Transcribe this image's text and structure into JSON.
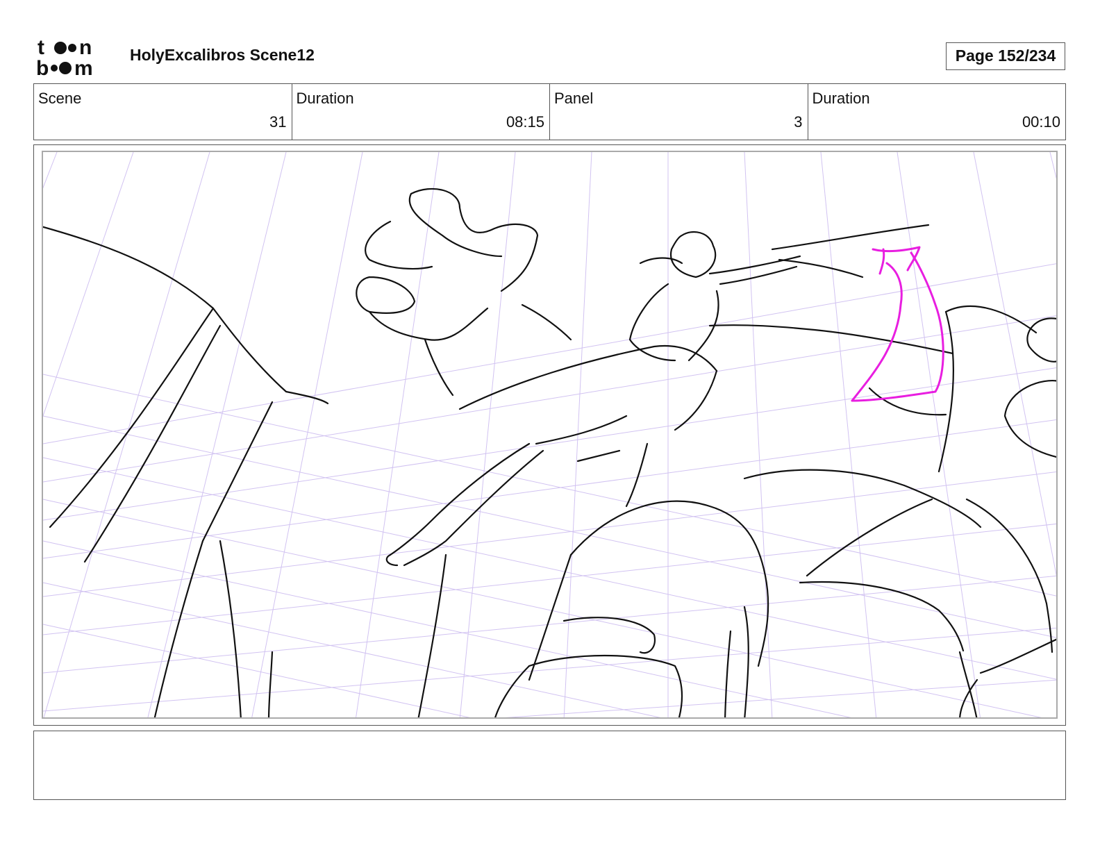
{
  "header": {
    "logo_text": "toon boom",
    "title": "HolyExcalibros Scene12",
    "page": "Page 152/234"
  },
  "info": [
    {
      "label": "Scene",
      "value": "31"
    },
    {
      "label": "Duration",
      "value": "08:15"
    },
    {
      "label": "Panel",
      "value": "3"
    },
    {
      "label": "Duration",
      "value": "00:10"
    }
  ],
  "panel": {
    "line_color": "#111111",
    "grid_color": "#c9b8ef",
    "arrow_color": "#e81ee0"
  },
  "notes": {
    "text": ""
  }
}
